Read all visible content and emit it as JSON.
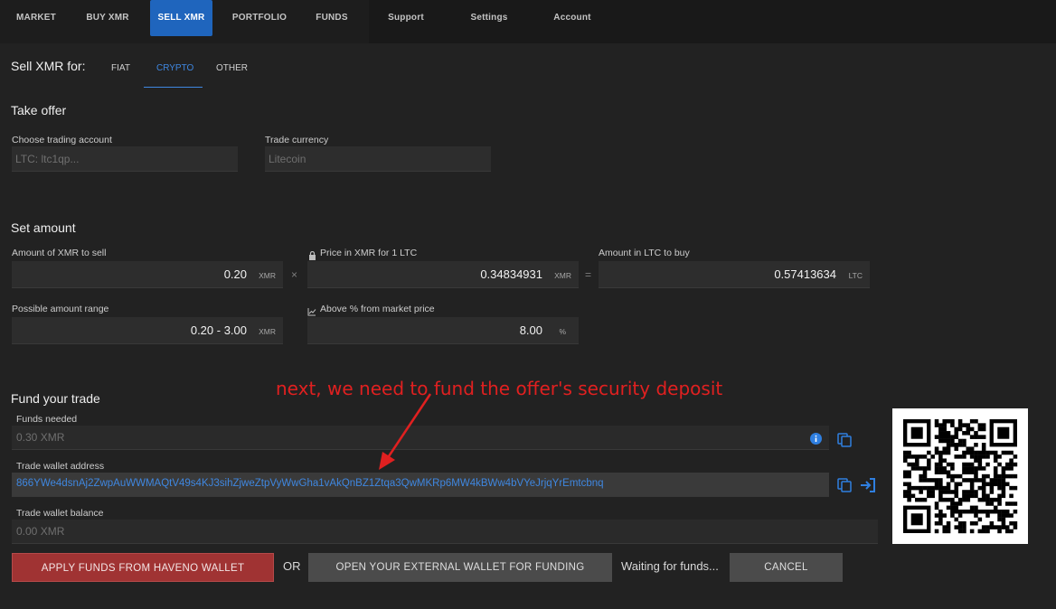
{
  "nav": {
    "items": [
      {
        "label": "MARKET"
      },
      {
        "label": "BUY XMR"
      },
      {
        "label": "SELL XMR"
      },
      {
        "label": "PORTFOLIO"
      },
      {
        "label": "FUNDS"
      },
      {
        "label": "Support"
      },
      {
        "label": "Settings"
      },
      {
        "label": "Account"
      }
    ],
    "active": "SELL XMR"
  },
  "sell_for": {
    "label": "Sell XMR for:",
    "tabs": [
      "FIAT",
      "CRYPTO",
      "OTHER"
    ],
    "active_tab": "CRYPTO"
  },
  "take_offer": {
    "title": "Take offer",
    "account_label": "Choose trading account",
    "account_value": "LTC: ltc1qp...",
    "currency_label": "Trade currency",
    "currency_value": "Litecoin"
  },
  "set_amount": {
    "title": "Set amount",
    "amount_label": "Amount of XMR to sell",
    "amount_value": "0.20",
    "amount_unit": "XMR",
    "times_symbol": "×",
    "price_label": "Price in XMR for 1 LTC",
    "price_value": "0.34834931",
    "price_unit": "XMR",
    "equals_symbol": "=",
    "ltc_label": "Amount in LTC to buy",
    "ltc_value": "0.57413634",
    "ltc_unit": "LTC",
    "range_label": "Possible amount range",
    "range_value": "0.20 - 3.00",
    "range_unit": "XMR",
    "above_label": "Above % from market price",
    "above_value": "8.00",
    "above_unit": "%"
  },
  "fund": {
    "title": "Fund your trade",
    "funds_needed_label": "Funds needed",
    "funds_needed_value": "0.30 XMR",
    "wallet_address_label": "Trade wallet address",
    "wallet_address_value": "866YWe4dsnAj2ZwpAuWWMAQtV49s4KJ3sihZjweZtpVyWwGha1vAkQnBZ1Ztqa3QwMKRp6MW4kBWw4bVYeJrjqYrEmtcbnq",
    "wallet_balance_label": "Trade wallet balance",
    "wallet_balance_value": "0.00 XMR"
  },
  "buttons": {
    "apply": "APPLY FUNDS FROM HAVENO WALLET",
    "or": "OR",
    "open_external": "OPEN YOUR EXTERNAL WALLET FOR FUNDING",
    "waiting": "Waiting for funds...",
    "cancel": "CANCEL"
  },
  "annotation": "next, we need to fund the offer's security deposit",
  "icons": {
    "info": "info-icon",
    "copy": "copy-icon",
    "open_wallet": "sign-in-icon",
    "lock": "lock-icon",
    "chart": "chart-line-icon",
    "qr": "qr-code-icon"
  },
  "colors": {
    "accent": "#1f65bd",
    "link": "#3f87e0",
    "apply_button": "#a03333",
    "annotation": "#e02020"
  }
}
